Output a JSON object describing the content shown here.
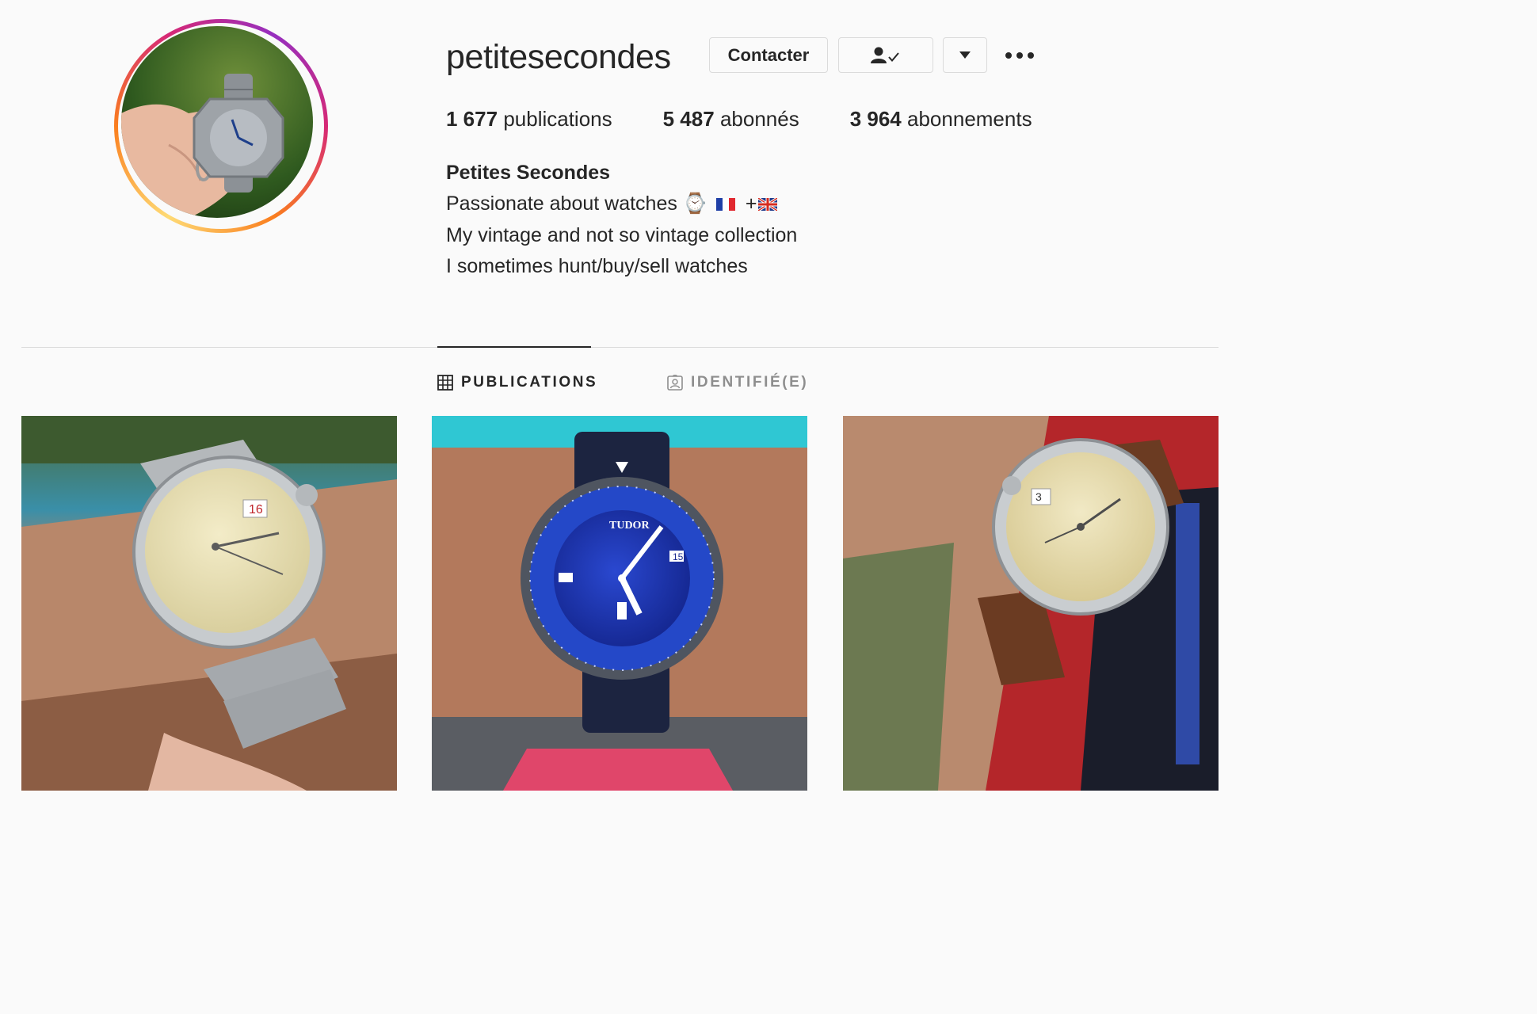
{
  "profile": {
    "username": "petitesecondes",
    "avatar_icon": "watch-in-hand-photo"
  },
  "actions": {
    "contact_label": "Contacter",
    "following_icon": "person-check-icon",
    "dropdown_icon": "caret-down-icon",
    "more_icon": "more-options-icon"
  },
  "stats": [
    {
      "count": "1 677",
      "label": "publications"
    },
    {
      "count": "5 487",
      "label": "abonnés"
    },
    {
      "count": "3 964",
      "label": "abonnements"
    }
  ],
  "bio": {
    "name": "Petites Secondes",
    "line1": "Passionate about watches ⌚",
    "line1_suffix": "+",
    "line2": "My vintage and not so vintage collection",
    "line3": "I sometimes hunt/buy/sell watches"
  },
  "tabs": [
    {
      "label": "PUBLICATIONS",
      "icon": "grid-icon",
      "active": true
    },
    {
      "label": "IDENTIFIÉ(E)",
      "icon": "tagged-person-icon",
      "active": false
    }
  ],
  "posts": [
    {
      "subject": "vintage-rolex-steel-bracelet"
    },
    {
      "subject": "tudor-pelagos-blue"
    },
    {
      "subject": "vintage-rolex-leather-strap"
    }
  ],
  "colors": {
    "text": "#262626",
    "muted": "#8e8e8e",
    "border": "#dbdbdb",
    "background": "#fafafa"
  }
}
